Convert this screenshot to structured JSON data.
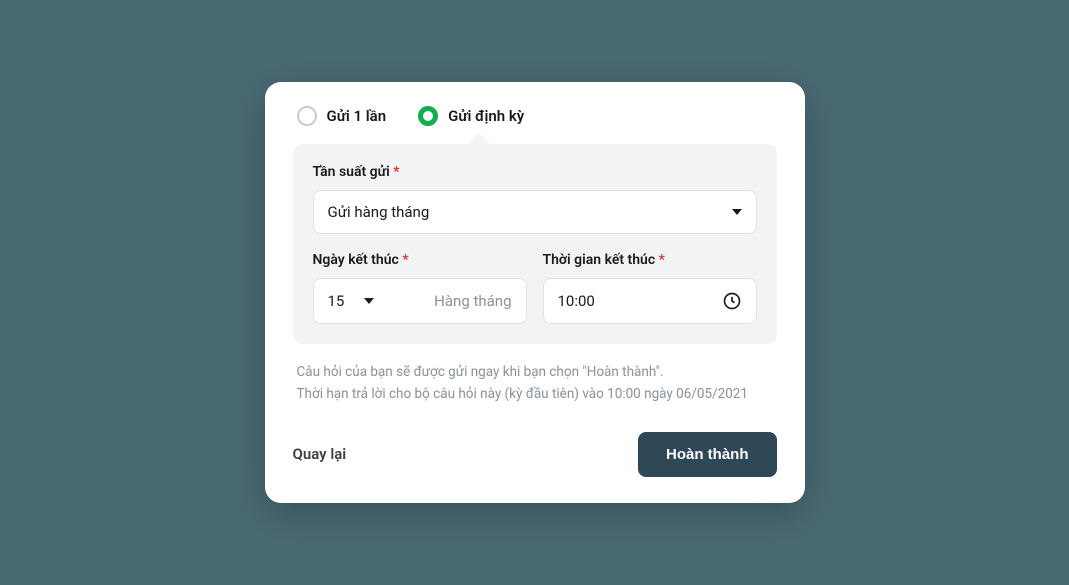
{
  "radio": {
    "once": "Gửi 1 lần",
    "recurring": "Gửi định kỳ"
  },
  "panel": {
    "frequency_label": "Tần suất gửi",
    "frequency_value": "Gửi hàng tháng",
    "end_date_label": "Ngày kết thúc",
    "end_date_day": "15",
    "end_date_unit": "Hàng tháng",
    "end_time_label": "Thời gian kết thúc",
    "end_time_value": "10:00"
  },
  "note": {
    "line1": "Câu hỏi của bạn sẽ được gửi ngay khi bạn chọn \"Hoàn thành\".",
    "line2": "Thời hạn trả lời cho bộ câu hỏi này (kỳ đầu tiên) vào 10:00 ngày 06/05/2021"
  },
  "footer": {
    "back": "Quay lại",
    "submit": "Hoàn thành"
  },
  "required_mark": "*"
}
